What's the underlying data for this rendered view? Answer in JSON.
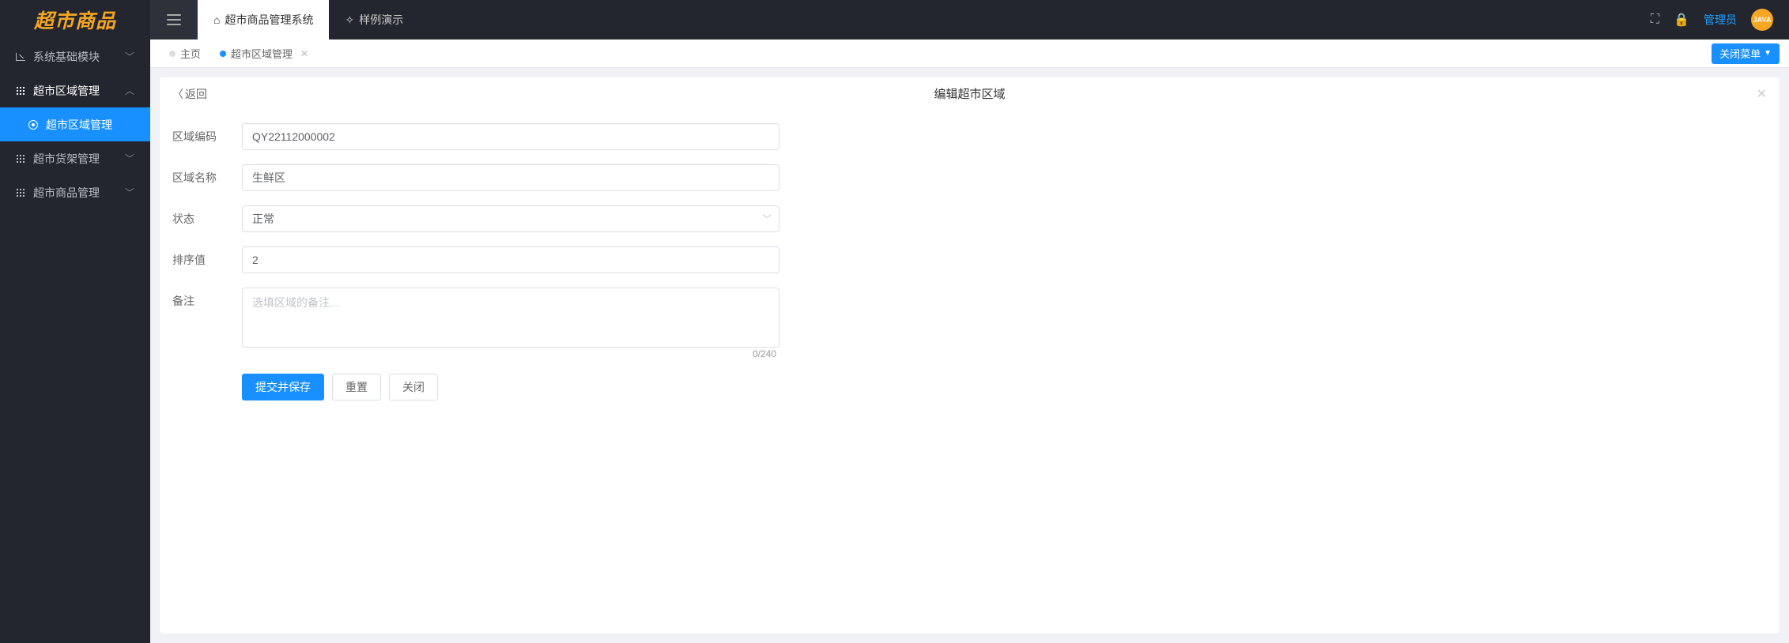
{
  "logo_text": "超市商品",
  "hamburger_label": "menu",
  "top_tabs": [
    {
      "label": "超市商品管理系统",
      "icon": "home"
    },
    {
      "label": "样例演示",
      "icon": "sparkle"
    }
  ],
  "header_right": {
    "admin_label": "管理员",
    "avatar_text": "JAVA"
  },
  "sidebar": {
    "items": [
      {
        "label": "系统基础模块",
        "icon": "chart",
        "expanded": false
      },
      {
        "label": "超市区域管理",
        "icon": "grid",
        "expanded": true,
        "children": [
          {
            "label": "超市区域管理",
            "active": true
          }
        ]
      },
      {
        "label": "超市货架管理",
        "icon": "grid",
        "expanded": false
      },
      {
        "label": "超市商品管理",
        "icon": "grid",
        "expanded": false
      }
    ]
  },
  "page_tabs": {
    "items": [
      {
        "label": "主页",
        "active": false,
        "closable": false
      },
      {
        "label": "超市区域管理",
        "active": true,
        "closable": true
      }
    ],
    "close_menu_label": "关闭菜单"
  },
  "panel": {
    "back_label": "返回",
    "title": "编辑超市区域"
  },
  "form": {
    "code": {
      "label": "区域编码",
      "value": "QY22112000002"
    },
    "name": {
      "label": "区域名称",
      "value": "生鲜区"
    },
    "status": {
      "label": "状态",
      "value": "正常"
    },
    "sort": {
      "label": "排序值",
      "value": "2"
    },
    "remark": {
      "label": "备注",
      "placeholder": "选填区域的备注...",
      "char_count": "0/240"
    },
    "actions": {
      "submit": "提交并保存",
      "reset": "重置",
      "close": "关闭"
    }
  }
}
